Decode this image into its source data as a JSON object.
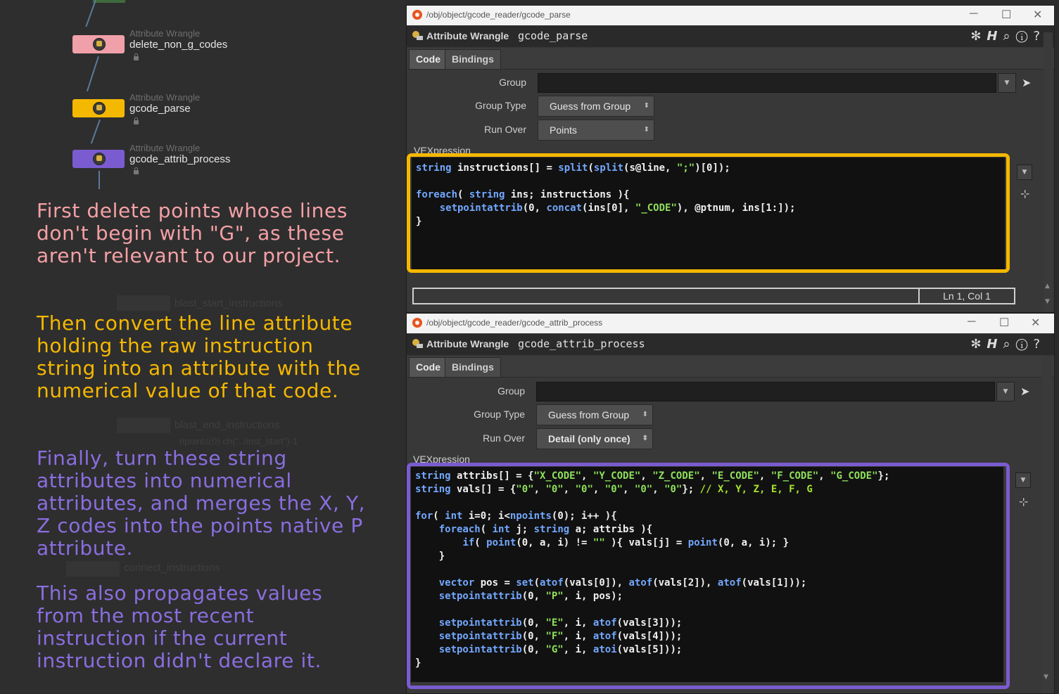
{
  "network": {
    "nodes": [
      {
        "type": "Attribute Wrangle",
        "name": "delete_non_g_codes",
        "color": "#f0a0a8"
      },
      {
        "type": "Attribute Wrangle",
        "name": "gcode_parse",
        "color": "#f5b800"
      },
      {
        "type": "Attribute Wrangle",
        "name": "gcode_attrib_process",
        "color": "#7a5cd0"
      }
    ],
    "ghost_labels": [
      "blast_start_instructions",
      "blast_end_instructions",
      "npoints(0) ch(\"../inst_start\")-1",
      "connect_instructions"
    ],
    "notes": [
      {
        "text": "First delete points whose lines don't begin with \"G\", as these aren't relevant to our project.",
        "color": "#f4a0a6"
      },
      {
        "text": "Then convert the line attribute holding the raw instruction string into an attribute with the numerical value of that code.",
        "color": "#f5b800"
      },
      {
        "text": "Finally, turn these string attributes into numerical attributes, and merges the X, Y, Z codes into the points native P attribute.",
        "color": "#8a6ee0"
      },
      {
        "text": "This also propagates values from the most recent instruction if the current instruction didn't declare it.",
        "color": "#8a6ee0"
      }
    ]
  },
  "windows": {
    "minimize": "─",
    "maximize": "☐",
    "close": "✕"
  },
  "parse_pane": {
    "path": "/obj/object/gcode_reader/gcode_parse",
    "node_type": "Attribute Wrangle",
    "node_name": "gcode_parse",
    "tabs": [
      "Code",
      "Bindings"
    ],
    "group_label": "Group",
    "group_value": "",
    "group_type_label": "Group Type",
    "group_type_value": "Guess from Group",
    "run_over_label": "Run Over",
    "run_over_value": "Points",
    "vex_label": "VEXpression",
    "status_position": "Ln 1, Col 1",
    "highlight_color": "#f5b800"
  },
  "process_pane": {
    "path": "/obj/object/gcode_reader/gcode_attrib_process",
    "node_type": "Attribute Wrangle",
    "node_name": "gcode_attrib_process",
    "tabs": [
      "Code",
      "Bindings"
    ],
    "group_label": "Group",
    "group_value": "",
    "group_type_label": "Group Type",
    "group_type_value": "Guess from Group",
    "run_over_label": "Run Over",
    "run_over_value": "Detail (only once)",
    "vex_label": "VEXpression",
    "highlight_color": "#7a5cd0"
  },
  "icons": [
    "settings-gear-icon",
    "help-h-icon",
    "search-icon",
    "info-icon",
    "question-icon",
    "dropdown-arrow-icon",
    "select-arrow-icon",
    "expand-icon",
    "lock-icon",
    "houdini-logo-icon"
  ]
}
